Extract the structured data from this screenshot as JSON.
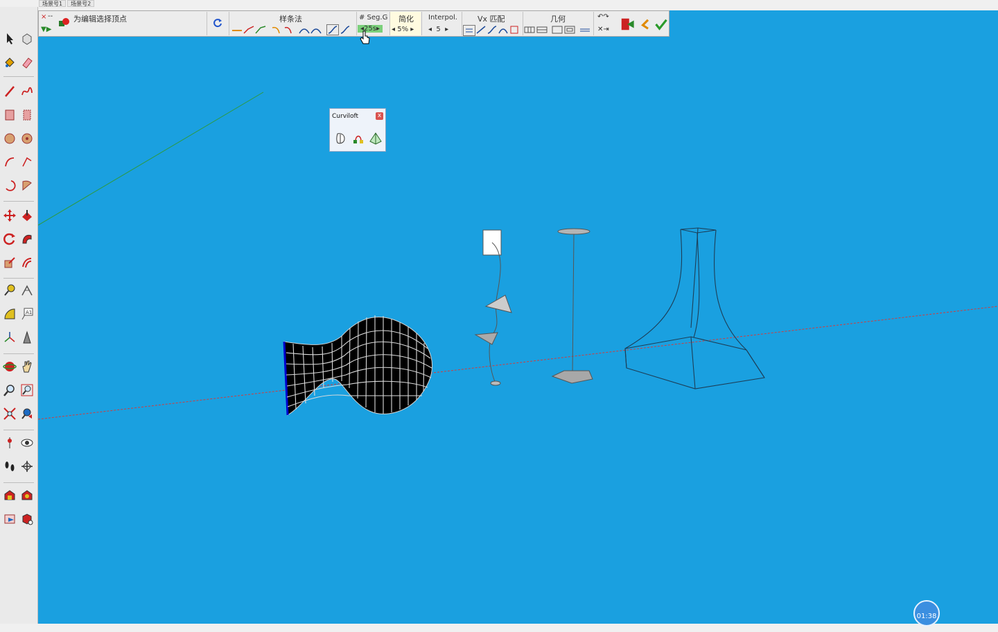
{
  "scene_tabs": [
    "场景号1",
    "场景号2"
  ],
  "status_text": "为编辑选择顶点",
  "toolbar": {
    "spline_label": "样条法",
    "seg_label": "# Seg.G",
    "seg_value": "25s",
    "simplify_label": "简化",
    "simplify_value": "5%",
    "interpol_label": "Interpol.",
    "interpol_value": "5",
    "vx_label": "Vx 匹配",
    "geometry_label": "几何",
    "close_symbol": "×",
    "dash_symbol": "--"
  },
  "curviloft": {
    "title": "Curviloft",
    "close": "x"
  },
  "timer": "01:38",
  "colors": {
    "viewport": "#1aa0e0",
    "axis_red": "#d23c3c",
    "axis_green": "#2e9a3c",
    "mesh_dark": "#000000"
  }
}
